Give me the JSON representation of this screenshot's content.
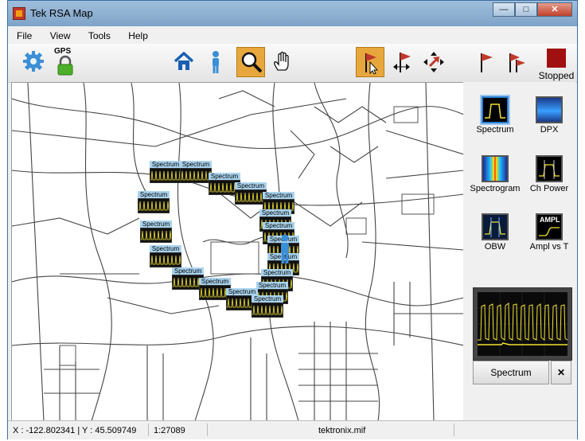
{
  "window": {
    "title": "Tek RSA Map",
    "min": "—",
    "max": "□",
    "close": "✕"
  },
  "menu": [
    "File",
    "View",
    "Tools",
    "Help"
  ],
  "toolbar": {
    "gps_label": "GPS",
    "stopped_label": "Stopped"
  },
  "map": {
    "marker_label": "Spectrum"
  },
  "side_panel": {
    "tools": [
      {
        "label": "Spectrum"
      },
      {
        "label": "DPX"
      },
      {
        "label": "Spectrogram"
      },
      {
        "label": "Ch Power"
      },
      {
        "label": "OBW"
      },
      {
        "label": "Ampl vs T"
      }
    ],
    "ampl_icon_text": "AMPL",
    "preview_label": "Spectrum",
    "preview_close": "✕"
  },
  "status": {
    "coords": "X : -122.802341 | Y : 45.509749",
    "scale": "1:27089",
    "file": "tektronix.mif"
  },
  "colors": {
    "accent_active": "#e8a73c",
    "flag_red": "#c0392b",
    "stop_red": "#a01010",
    "home_blue": "#1a5fb4"
  }
}
